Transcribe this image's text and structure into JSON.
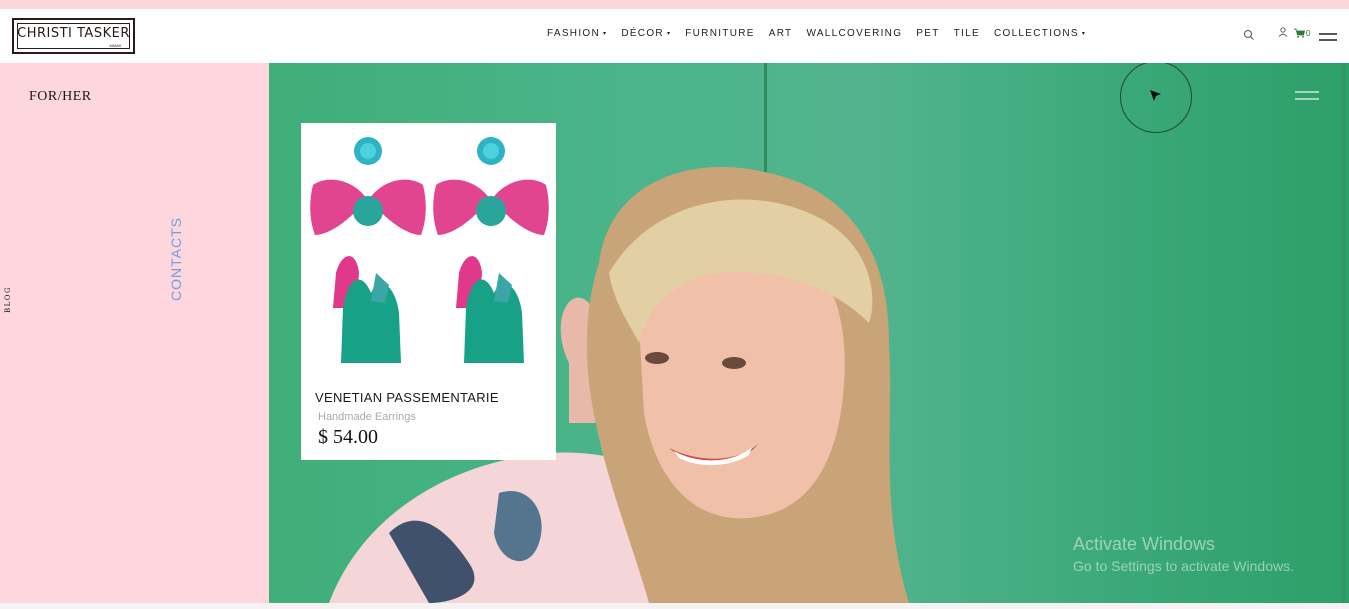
{
  "brand": {
    "name": "CHRISTI TASKER",
    "sub": "MIAMI"
  },
  "nav": {
    "items": [
      {
        "label": "FASHION",
        "has_dropdown": true
      },
      {
        "label": "DÉCOR",
        "has_dropdown": true
      },
      {
        "label": "FURNITURE",
        "has_dropdown": false
      },
      {
        "label": "ART",
        "has_dropdown": false
      },
      {
        "label": "WALLCOVERING",
        "has_dropdown": false
      },
      {
        "label": "PET",
        "has_dropdown": false
      },
      {
        "label": "TILE",
        "has_dropdown": false
      },
      {
        "label": "COLLECTIONS",
        "has_dropdown": true
      }
    ],
    "caret": "▾"
  },
  "utilities": {
    "cart_count": "0",
    "icons": [
      "search-icon",
      "user-icon",
      "cart-icon",
      "menu-icon"
    ]
  },
  "sidebar": {
    "title": "FOR/HER",
    "contacts_label": "CONTACTS",
    "blog_label": "BLOG"
  },
  "product": {
    "name": "VENETIAN PASSEMENTARIE",
    "category": "Handmade Earrings",
    "price": "$ 54.00"
  },
  "watermark": {
    "title": "Activate Windows",
    "subtitle": "Go to Settings to activate Windows."
  },
  "colors": {
    "panel_pink": "#fdd6de",
    "hero_green": "#4ab489",
    "contacts_blue": "#6f9fe0",
    "cart_green": "#2d7a3a"
  }
}
